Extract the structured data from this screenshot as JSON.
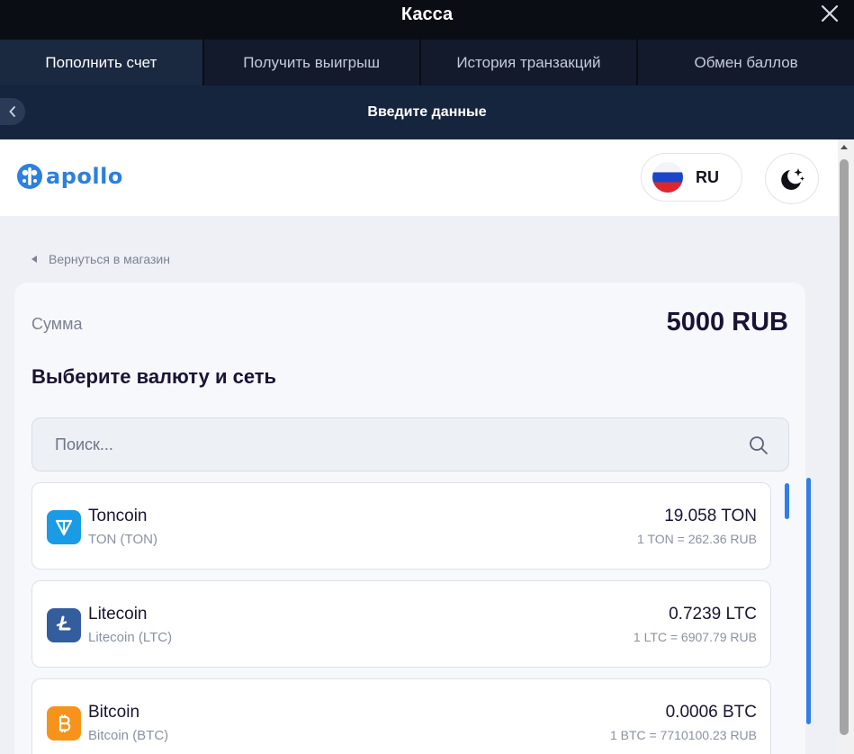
{
  "window": {
    "title": "Касса",
    "close_icon": "close-icon"
  },
  "tabs": [
    {
      "label": "Пополнить счет",
      "active": true
    },
    {
      "label": "Получить выигрыш",
      "active": false
    },
    {
      "label": "История транзакций",
      "active": false
    },
    {
      "label": "Обмен баллов",
      "active": false
    }
  ],
  "subheader": {
    "title": "Введите данные",
    "back_icon": "chevron-left-icon"
  },
  "site": {
    "logo": "apollo",
    "language": "RU",
    "theme_icon": "moon-stars-icon",
    "back_link": "Вернуться в магазин"
  },
  "payment": {
    "amount_label": "Сумма",
    "amount_value": "5000 RUB",
    "section_title": "Выберите валюту и сеть",
    "search_placeholder": "Поиск...",
    "coins": [
      {
        "name": "Toncoin",
        "sub": "TON (TON)",
        "amount": "19.058 TON",
        "rate": "1 TON = 262.36 RUB",
        "icon": "toncoin-icon",
        "color": "#1a9be6"
      },
      {
        "name": "Litecoin",
        "sub": "Litecoin (LTC)",
        "amount": "0.7239 LTC",
        "rate": "1 LTC = 6907.79 RUB",
        "icon": "litecoin-icon",
        "color": "#345d9d"
      },
      {
        "name": "Bitcoin",
        "sub": "Bitcoin (BTC)",
        "amount": "0.0006 BTC",
        "rate": "1 BTC = 7710100.23 RUB",
        "icon": "bitcoin-icon",
        "color": "#f7931a"
      }
    ]
  },
  "colors": {
    "accent": "#2f7fe6",
    "dark_bg": "#0b0d14",
    "tab_active": "#1a2840",
    "subheader": "#15253d"
  }
}
